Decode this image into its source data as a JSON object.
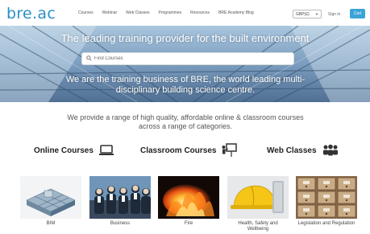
{
  "header": {
    "logo": "bre.ac",
    "nav": [
      "Courses",
      "Webinar",
      "Web Classes",
      "Programmes",
      "Resources",
      "BRE Academy Blog"
    ],
    "currency": "GBP(£)",
    "sign_in": "Sign in",
    "cart": "Cart"
  },
  "hero": {
    "title": "The leading training provider for the built environment",
    "search_placeholder": "Find Courses",
    "subtitle": "We are the training business of BRE, the world leading multi-disciplinary building science centre."
  },
  "intro": "We provide a range of high quality, affordable online & classroom courses across a range of categories.",
  "categories": [
    {
      "label": "Online Courses",
      "icon": "laptop-icon"
    },
    {
      "label": "Classroom Courses",
      "icon": "presenter-icon"
    },
    {
      "label": "Web Classes",
      "icon": "group-icon"
    }
  ],
  "tiles": [
    {
      "label": "BIM"
    },
    {
      "label": "Business"
    },
    {
      "label": "Fire"
    },
    {
      "label": "Health, Safety and Wellbeing"
    },
    {
      "label": "Legislation and Regulation"
    }
  ],
  "colors": {
    "brand": "#2a8fc8",
    "cart": "#3aa3d8"
  }
}
